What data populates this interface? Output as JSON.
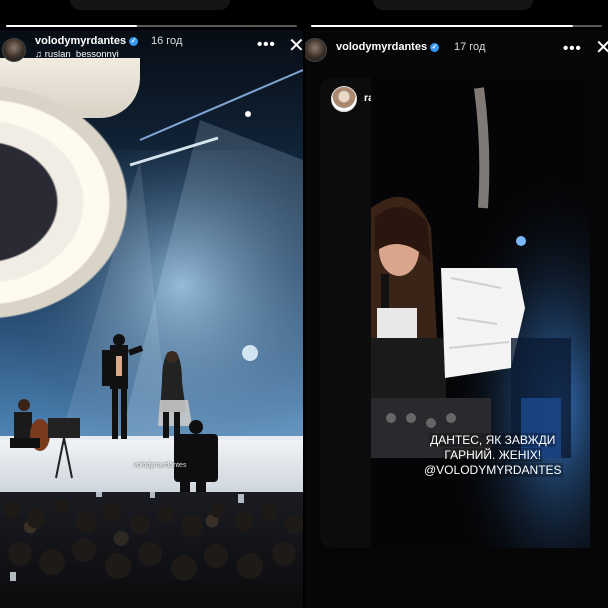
{
  "stories": [
    {
      "username": "volodymyrdantes",
      "time": "16 год",
      "audio_credit": "ruslan_bessonnyi",
      "sticker": "volodymyrdantes",
      "progress": 0.45
    },
    {
      "username": "volodymyrdantes",
      "time": "17 год",
      "repost_user": "raminalalala",
      "caption_lines": [
        "ДАНТЕС, ЯК ЗАВЖДИ",
        "ГАРНИЙ. ЖЕНІХ!",
        "@VOLODYMYRDANTES"
      ],
      "progress": 0.9
    }
  ],
  "icons": {
    "more": "more-icon",
    "close": "close-icon",
    "verified": "verified-badge-icon",
    "audio": "music-icon"
  },
  "colors": {
    "verified": "#3897f0",
    "stage_light": "#3a7fd0"
  }
}
